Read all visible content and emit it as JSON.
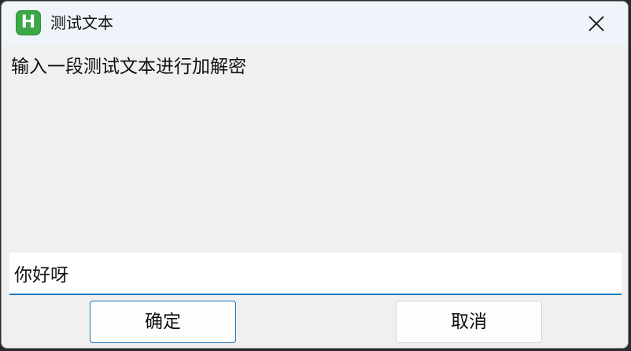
{
  "window": {
    "title": "测试文本",
    "icon": "app-h-icon",
    "icon_letter": "H",
    "close_icon": "close-icon"
  },
  "dialog": {
    "prompt": "输入一段测试文本进行加解密",
    "input_value": "你好呀",
    "ok_label": "确定",
    "cancel_label": "取消"
  },
  "colors": {
    "accent": "#1f7ab8",
    "icon_green": "#3aa845",
    "background": "#f0f0f0",
    "titlebar": "#eef4f9"
  }
}
